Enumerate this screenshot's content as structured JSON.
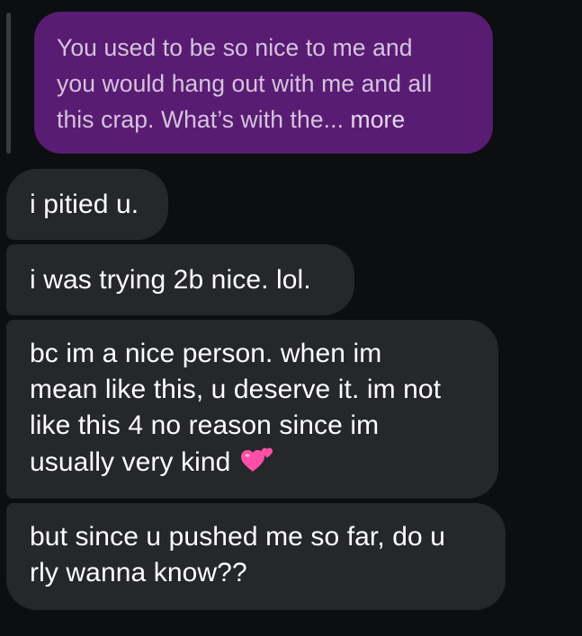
{
  "quoted_message": {
    "lines": [
      "You used to be so nice to me and",
      "you would hang out with me and all",
      "this crap. What’s with the..."
    ],
    "more_label": "more"
  },
  "messages": [
    {
      "lines": [
        "i pitied u."
      ]
    },
    {
      "lines": [
        "i was trying 2b nice. lol."
      ]
    },
    {
      "lines": [
        "bc im a nice person. when im",
        "mean like this, u deserve it. im not",
        "like this 4 no reason since im",
        "usually very kind"
      ],
      "emoji": "two-hearts-icon"
    },
    {
      "lines": [
        "but since u pushed me so far, do u",
        "rly wanna know??"
      ]
    }
  ],
  "colors": {
    "background": "#0d0e12",
    "quoted_bubble": "#591c73",
    "incoming_bubble": "#25272b",
    "heart": "#ff4fa6"
  }
}
